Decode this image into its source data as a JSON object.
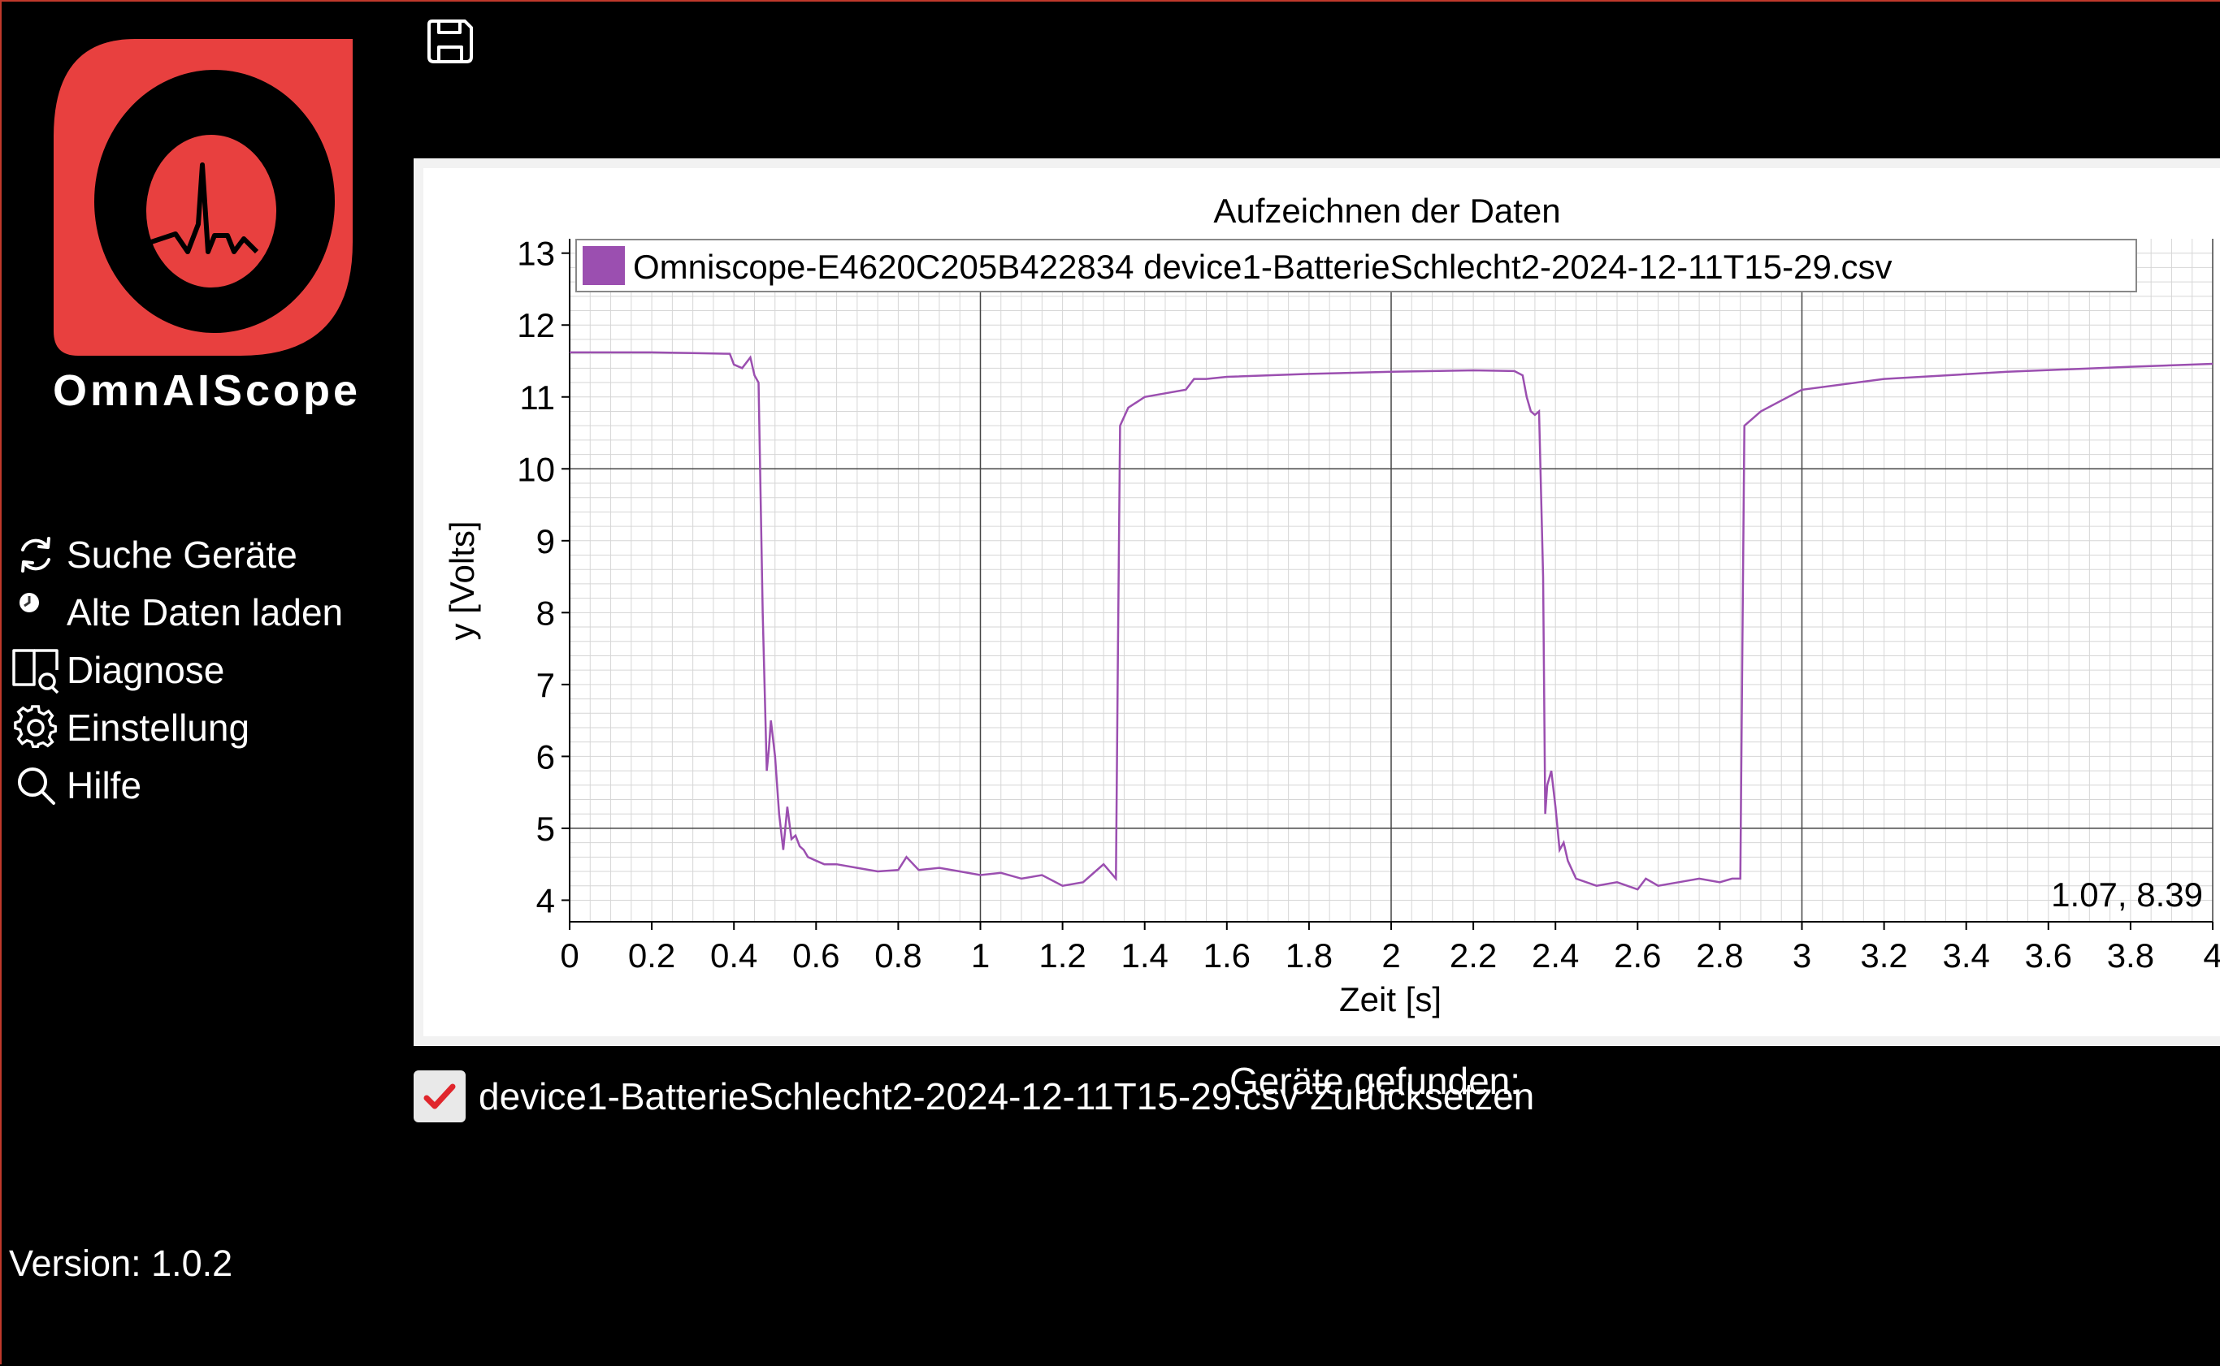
{
  "app": {
    "name": "OmnAIScope",
    "version": "Version: 1.0.2",
    "brand_color": "#e8403f"
  },
  "sidebar": {
    "items": [
      {
        "label": "Suche Geräte",
        "icon": "refresh-icon"
      },
      {
        "label": "Alte Daten laden",
        "icon": "load-data-icon"
      },
      {
        "label": "Diagnose",
        "icon": "book-search-icon"
      },
      {
        "label": "Einstellung",
        "icon": "gear-icon"
      },
      {
        "label": "Hilfe",
        "icon": "search-icon"
      }
    ]
  },
  "toolbar": {
    "save_icon": "save-icon"
  },
  "plot": {
    "cursor_readout": "1.07, 8.39"
  },
  "chart_data": {
    "type": "line",
    "title": "Aufzeichnen der Daten",
    "xlabel": "Zeit [s]",
    "ylabel": "y [Volts]",
    "xlim": [
      0,
      4
    ],
    "ylim": [
      3.7,
      13.2
    ],
    "x_ticks": [
      "0",
      "0.2",
      "0.4",
      "0.6",
      "0.8",
      "1",
      "1.2",
      "1.4",
      "1.6",
      "1.8",
      "2",
      "2.2",
      "2.4",
      "2.6",
      "2.8",
      "3",
      "3.2",
      "3.4",
      "3.6",
      "3.8",
      "4"
    ],
    "y_ticks": [
      "4",
      "5",
      "6",
      "7",
      "8",
      "9",
      "10",
      "11",
      "12",
      "13"
    ],
    "grid": true,
    "legend_position": "top-left",
    "series": [
      {
        "name": "Omniscope-E4620C205B422834 device1-BatterieSchlecht2-2024-12-11T15-29.csv",
        "color": "#9b4fb0",
        "x": [
          0,
          0.1,
          0.2,
          0.3,
          0.39,
          0.4,
          0.42,
          0.44,
          0.45,
          0.46,
          0.47,
          0.48,
          0.485,
          0.49,
          0.5,
          0.51,
          0.52,
          0.53,
          0.54,
          0.55,
          0.56,
          0.57,
          0.58,
          0.6,
          0.62,
          0.65,
          0.7,
          0.75,
          0.8,
          0.82,
          0.85,
          0.9,
          0.95,
          1.0,
          1.05,
          1.1,
          1.15,
          1.2,
          1.25,
          1.28,
          1.3,
          1.33,
          1.335,
          1.34,
          1.36,
          1.4,
          1.45,
          1.5,
          1.52,
          1.55,
          1.6,
          1.8,
          2.0,
          2.2,
          2.3,
          2.32,
          2.33,
          2.34,
          2.35,
          2.36,
          2.37,
          2.375,
          2.38,
          2.39,
          2.4,
          2.41,
          2.42,
          2.43,
          2.45,
          2.5,
          2.55,
          2.6,
          2.62,
          2.65,
          2.7,
          2.75,
          2.8,
          2.83,
          2.85,
          2.855,
          2.86,
          2.9,
          2.95,
          3.0,
          3.2,
          3.5,
          3.8,
          4.0
        ],
        "values": [
          11.62,
          11.62,
          11.62,
          11.61,
          11.6,
          11.45,
          11.4,
          11.55,
          11.3,
          11.2,
          8.0,
          5.8,
          6.1,
          6.5,
          6.0,
          5.2,
          4.7,
          5.3,
          4.85,
          4.9,
          4.75,
          4.7,
          4.6,
          4.55,
          4.5,
          4.5,
          4.45,
          4.4,
          4.42,
          4.6,
          4.42,
          4.45,
          4.4,
          4.35,
          4.38,
          4.3,
          4.35,
          4.2,
          4.25,
          4.4,
          4.5,
          4.3,
          7.5,
          10.6,
          10.85,
          11.0,
          11.05,
          11.1,
          11.25,
          11.25,
          11.28,
          11.32,
          11.35,
          11.37,
          11.36,
          11.3,
          11.0,
          10.8,
          10.75,
          10.8,
          8.5,
          5.2,
          5.6,
          5.8,
          5.3,
          4.7,
          4.8,
          4.55,
          4.3,
          4.2,
          4.25,
          4.15,
          4.3,
          4.2,
          4.25,
          4.3,
          4.25,
          4.3,
          4.3,
          7.5,
          10.6,
          10.8,
          10.95,
          11.1,
          11.25,
          11.35,
          11.42,
          11.46
        ]
      }
    ]
  },
  "devices": {
    "found_label": "Geräte gefunden:",
    "items": [
      {
        "name": "device1-BatterieSchlecht2-2024-12-11T15-29.csv",
        "checked": true,
        "reset_label": "Zurücksetzen"
      }
    ]
  }
}
